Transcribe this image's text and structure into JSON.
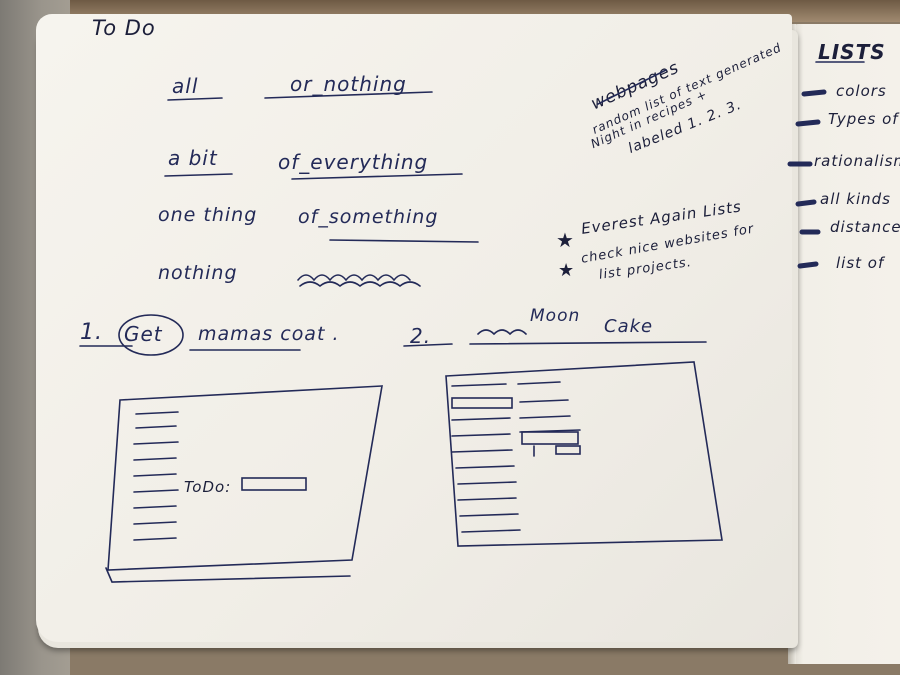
{
  "notebook": {
    "title": "To Do",
    "left_column": [
      {
        "a": "all",
        "b": "or_nothing"
      },
      {
        "a": "a bit",
        "b": "of_everything"
      },
      {
        "a": "one thing",
        "b": "of_something"
      },
      {
        "a": "nothing",
        "b": ""
      }
    ],
    "webpages": {
      "heading": "webpages",
      "lines": [
        "Night in recipes +",
        "random list of text generated",
        "labeled 1. 2. 3."
      ]
    },
    "notes": [
      {
        "star": "★",
        "text": "Everest Again Lists"
      },
      {
        "star": "★",
        "text": "check nice websites for"
      },
      {
        "star": "",
        "text": "list projects."
      }
    ],
    "tasks": {
      "item1_num": "1.",
      "item1_word": "Get",
      "item1_rest": "mamas coat .",
      "item2_num": "2.",
      "item2_above": "Moon",
      "item2_rest": "Cake"
    },
    "sketch_left_field_label": "ToDo:",
    "right_page": {
      "heading": "LISTS",
      "items": [
        "colors",
        "Types of",
        "rationalism",
        "all kinds",
        "distance",
        "list of"
      ]
    }
  },
  "colors": {
    "ink": "#232a58",
    "paper": "#f4f1ea",
    "backdrop": "#8a7a66"
  }
}
